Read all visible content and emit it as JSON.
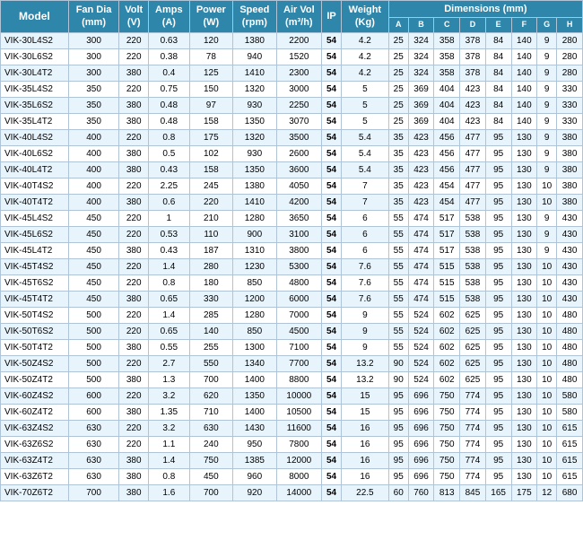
{
  "table": {
    "headers_row1": [
      {
        "label": "Model",
        "rowspan": 2,
        "colspan": 1
      },
      {
        "label": "Fan Dia (mm)",
        "rowspan": 2,
        "colspan": 1
      },
      {
        "label": "Volt (V)",
        "rowspan": 2,
        "colspan": 1
      },
      {
        "label": "Amps (A)",
        "rowspan": 2,
        "colspan": 1
      },
      {
        "label": "Power (W)",
        "rowspan": 2,
        "colspan": 1
      },
      {
        "label": "Speed (rpm)",
        "rowspan": 2,
        "colspan": 1
      },
      {
        "label": "Air Vol (m³/h)",
        "rowspan": 2,
        "colspan": 1
      },
      {
        "label": "IP",
        "rowspan": 2,
        "colspan": 1
      },
      {
        "label": "Weight (Kg)",
        "rowspan": 2,
        "colspan": 1
      },
      {
        "label": "Dimensions (mm)",
        "rowspan": 1,
        "colspan": 8
      }
    ],
    "headers_row2": [
      "A",
      "B",
      "C",
      "D",
      "E",
      "F",
      "G",
      "H"
    ],
    "rows": [
      [
        "VIK-30L4S2",
        300,
        220,
        0.63,
        120,
        1380,
        2200,
        54,
        4.2,
        25,
        324,
        358,
        378,
        84,
        140,
        9,
        280
      ],
      [
        "VIK-30L6S2",
        300,
        220,
        0.38,
        78,
        940,
        1520,
        54,
        4.2,
        25,
        324,
        358,
        378,
        84,
        140,
        9,
        280
      ],
      [
        "VIK-30L4T2",
        300,
        380,
        0.4,
        125,
        1410,
        2300,
        54,
        4.2,
        25,
        324,
        358,
        378,
        84,
        140,
        9,
        280
      ],
      [
        "VIK-35L4S2",
        350,
        220,
        0.75,
        150,
        1320,
        3000,
        54,
        5,
        25,
        369,
        404,
        423,
        84,
        140,
        9,
        330
      ],
      [
        "VIK-35L6S2",
        350,
        380,
        0.48,
        97,
        930,
        2250,
        54,
        5,
        25,
        369,
        404,
        423,
        84,
        140,
        9,
        330
      ],
      [
        "VIK-35L4T2",
        350,
        380,
        0.48,
        158,
        1350,
        3070,
        54,
        5,
        25,
        369,
        404,
        423,
        84,
        140,
        9,
        330
      ],
      [
        "VIK-40L4S2",
        400,
        220,
        0.8,
        175,
        1320,
        3500,
        54,
        5.4,
        35,
        423,
        456,
        477,
        95,
        130,
        9,
        380
      ],
      [
        "VIK-40L6S2",
        400,
        380,
        0.5,
        102,
        930,
        2600,
        54,
        5.4,
        35,
        423,
        456,
        477,
        95,
        130,
        9,
        380
      ],
      [
        "VIK-40L4T2",
        400,
        380,
        0.43,
        158,
        1350,
        3600,
        54,
        5.4,
        35,
        423,
        456,
        477,
        95,
        130,
        9,
        380
      ],
      [
        "VIK-40T4S2",
        400,
        220,
        2.25,
        245,
        1380,
        4050,
        54,
        7,
        35,
        423,
        454,
        477,
        95,
        130,
        10,
        380
      ],
      [
        "VIK-40T4T2",
        400,
        380,
        0.6,
        220,
        1410,
        4200,
        54,
        7,
        35,
        423,
        454,
        477,
        95,
        130,
        10,
        380
      ],
      [
        "VIK-45L4S2",
        450,
        220,
        1,
        210,
        1280,
        3650,
        54,
        6,
        55,
        474,
        517,
        538,
        95,
        130,
        9,
        430
      ],
      [
        "VIK-45L6S2",
        450,
        220,
        0.53,
        110,
        900,
        3100,
        54,
        6,
        55,
        474,
        517,
        538,
        95,
        130,
        9,
        430
      ],
      [
        "VIK-45L4T2",
        450,
        380,
        0.43,
        187,
        1310,
        3800,
        54,
        6,
        55,
        474,
        517,
        538,
        95,
        130,
        9,
        430
      ],
      [
        "VIK-45T4S2",
        450,
        220,
        1.4,
        280,
        1230,
        5300,
        54,
        7.6,
        55,
        474,
        515,
        538,
        95,
        130,
        10,
        430
      ],
      [
        "VIK-45T6S2",
        450,
        220,
        0.8,
        180,
        850,
        4800,
        54,
        7.6,
        55,
        474,
        515,
        538,
        95,
        130,
        10,
        430
      ],
      [
        "VIK-45T4T2",
        450,
        380,
        0.65,
        330,
        1200,
        6000,
        54,
        7.6,
        55,
        474,
        515,
        538,
        95,
        130,
        10,
        430
      ],
      [
        "VIK-50T4S2",
        500,
        220,
        1.4,
        285,
        1280,
        7000,
        54,
        9,
        55,
        524,
        602,
        625,
        95,
        130,
        10,
        480
      ],
      [
        "VIK-50T6S2",
        500,
        220,
        0.65,
        140,
        850,
        4500,
        54,
        9,
        55,
        524,
        602,
        625,
        95,
        130,
        10,
        480
      ],
      [
        "VIK-50T4T2",
        500,
        380,
        0.55,
        255,
        1300,
        7100,
        54,
        9,
        55,
        524,
        602,
        625,
        95,
        130,
        10,
        480
      ],
      [
        "VIK-50Z4S2",
        500,
        220,
        2.7,
        550,
        1340,
        7700,
        54,
        13.2,
        90,
        524,
        602,
        625,
        95,
        130,
        10,
        480
      ],
      [
        "VIK-50Z4T2",
        500,
        380,
        1.3,
        700,
        1400,
        8800,
        54,
        13.2,
        90,
        524,
        602,
        625,
        95,
        130,
        10,
        480
      ],
      [
        "VIK-60Z4S2",
        600,
        220,
        3.2,
        620,
        1350,
        10000,
        54,
        15,
        95,
        696,
        750,
        774,
        95,
        130,
        10,
        580
      ],
      [
        "VIK-60Z4T2",
        600,
        380,
        1.35,
        710,
        1400,
        10500,
        54,
        15,
        95,
        696,
        750,
        774,
        95,
        130,
        10,
        580
      ],
      [
        "VIK-63Z4S2",
        630,
        220,
        3.2,
        630,
        1430,
        11600,
        54,
        16,
        95,
        696,
        750,
        774,
        95,
        130,
        10,
        615
      ],
      [
        "VIK-63Z6S2",
        630,
        220,
        1.1,
        240,
        950,
        7800,
        54,
        16,
        95,
        696,
        750,
        774,
        95,
        130,
        10,
        615
      ],
      [
        "VIK-63Z4T2",
        630,
        380,
        1.4,
        750,
        1385,
        12000,
        54,
        16,
        95,
        696,
        750,
        774,
        95,
        130,
        10,
        615
      ],
      [
        "VIK-63Z6T2",
        630,
        380,
        0.8,
        450,
        960,
        8000,
        54,
        16,
        95,
        696,
        750,
        774,
        95,
        130,
        10,
        615
      ],
      [
        "VIK-70Z6T2",
        700,
        380,
        1.6,
        700,
        920,
        14000,
        54,
        22.5,
        60,
        760,
        813,
        845,
        165,
        175,
        12,
        680
      ]
    ]
  }
}
